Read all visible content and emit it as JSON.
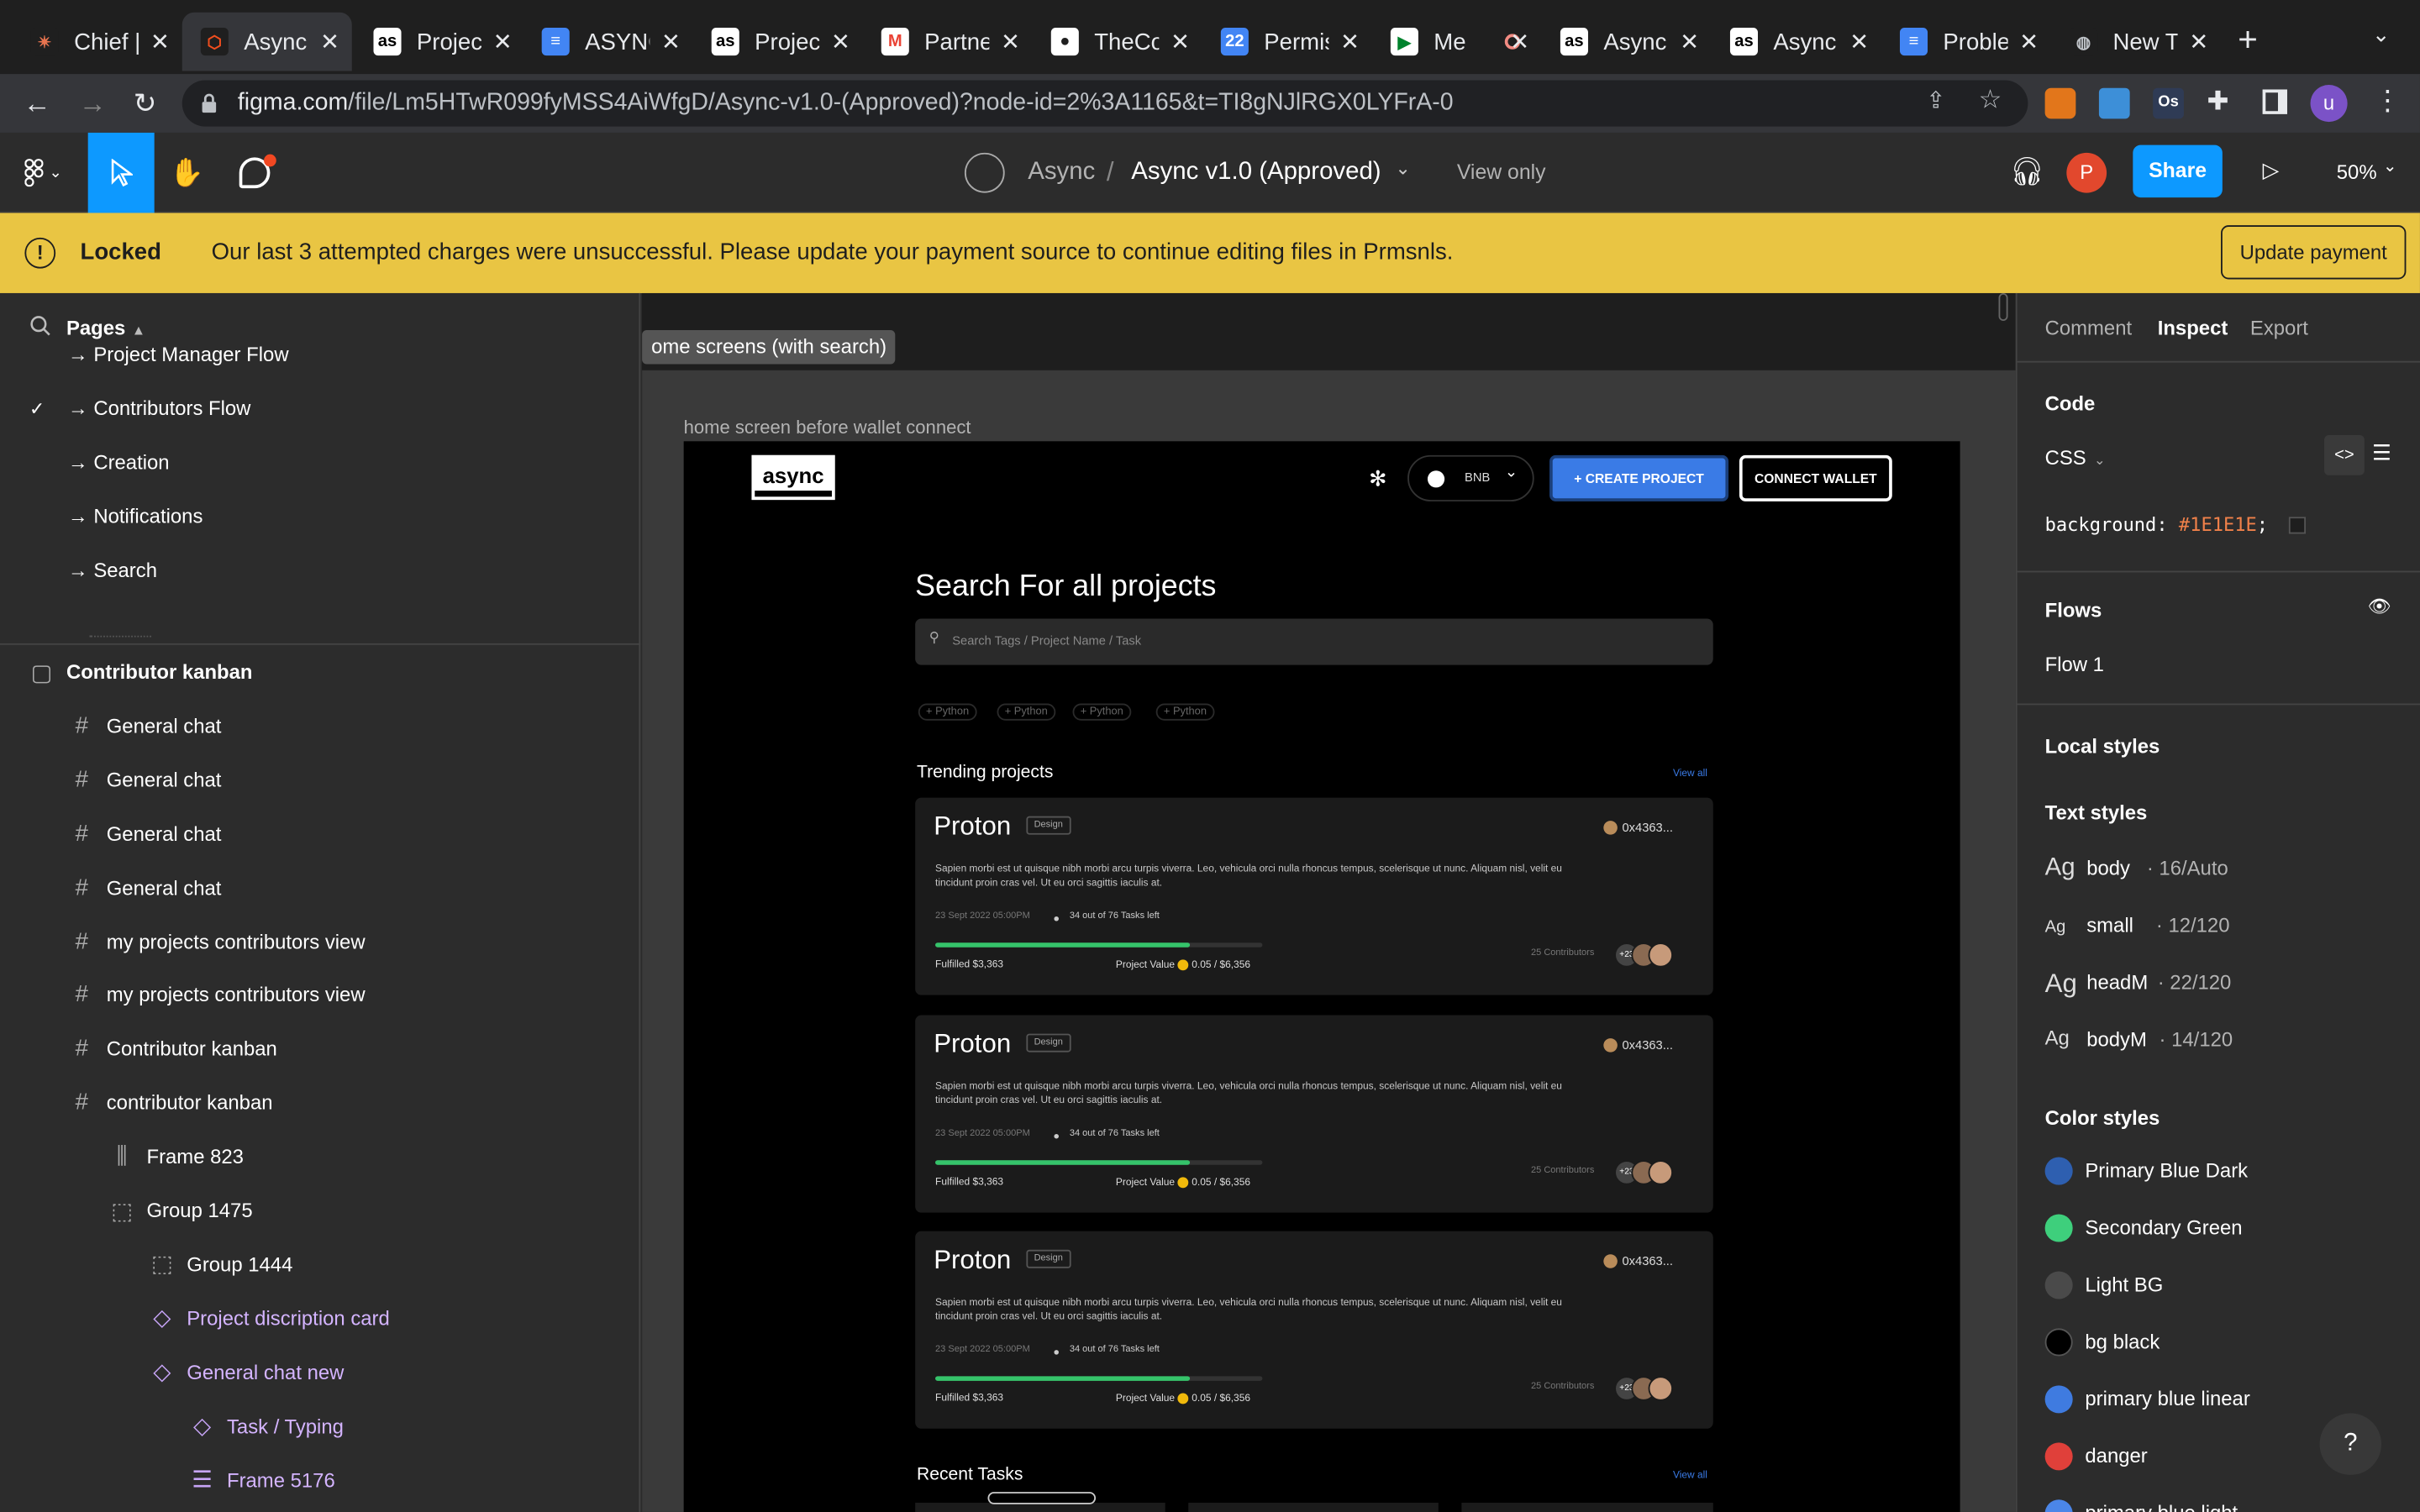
{
  "browser": {
    "tabs": [
      {
        "label": "Chief |",
        "icon": "claude-icon"
      },
      {
        "label": "Async",
        "icon": "figma-icon"
      },
      {
        "label": "Projec",
        "icon": "async-icon"
      },
      {
        "label": "ASYNC",
        "icon": "docs-icon"
      },
      {
        "label": "Projec",
        "icon": "async-icon"
      },
      {
        "label": "Partne",
        "icon": "gmail-icon"
      },
      {
        "label": "TheCo",
        "icon": "github-icon"
      },
      {
        "label": "Permis",
        "icon": "calendar-icon"
      },
      {
        "label": "Me",
        "icon": "meet-icon"
      },
      {
        "label": "Async",
        "icon": "async-icon"
      },
      {
        "label": "Async",
        "icon": "async-icon"
      },
      {
        "label": "Proble",
        "icon": "docs-icon"
      },
      {
        "label": "New T",
        "icon": "globe-icon"
      }
    ],
    "url_domain": "figma.com",
    "url_path": "/file/Lm5HTwR099fyMSS4AiWfgD/Async-v1.0-(Approved)?node-id=2%3A1165&t=TI8gNJlRGX0LYFrA-0",
    "profile_initial": "u"
  },
  "toolbar": {
    "team": "Async",
    "separator": "/",
    "file_name": "Async v1.0 (Approved)",
    "mode": "View only",
    "user_initial": "P",
    "share_label": "Share",
    "zoom": "50%"
  },
  "banner": {
    "title": "Locked",
    "message": "Our last 3 attempted charges were unsuccessful. Please update your payment source to continue editing files in Prmsnls.",
    "button": "Update payment"
  },
  "pages": {
    "header": "Pages",
    "items": [
      "→ Project Manager Flow",
      "→ Contributors Flow",
      "→ Creation",
      "→ Notifications",
      "→ Search"
    ]
  },
  "layers": [
    {
      "label": "Contributor kanban",
      "icon": "frame-outline-icon"
    },
    {
      "label": "General chat",
      "icon": "hash-icon"
    },
    {
      "label": "General chat",
      "icon": "hash-icon"
    },
    {
      "label": "General chat",
      "icon": "hash-icon"
    },
    {
      "label": "General chat",
      "icon": "hash-icon"
    },
    {
      "label": "my projects contributors view",
      "icon": "hash-icon"
    },
    {
      "label": "my projects contributors view",
      "icon": "hash-icon"
    },
    {
      "label": "Contributor kanban",
      "icon": "hash-icon"
    },
    {
      "label": "contributor kanban",
      "icon": "hash-icon"
    },
    {
      "label": "Frame 823",
      "icon": "columns-icon"
    },
    {
      "label": "Group 1475",
      "icon": "group-icon"
    },
    {
      "label": "Group 1444",
      "icon": "group-icon"
    },
    {
      "label": "Project discription card",
      "icon": "component-icon"
    },
    {
      "label": "General chat new",
      "icon": "component-icon"
    },
    {
      "label": "Task / Typing",
      "icon": "component-outline-icon"
    },
    {
      "label": "Frame 5176",
      "icon": "rows-icon"
    }
  ],
  "canvas": {
    "section_label": "ome screens (with search)",
    "frame_label": "home screen before wallet connect",
    "design": {
      "logo": "async",
      "network": "BNB",
      "create_button": "+ CREATE PROJECT",
      "connect_button": "CONNECT WALLET",
      "heading": "Search For all projects",
      "search_placeholder": "Search Tags / Project Name / Task",
      "tags": [
        "+ Python",
        "+ Python",
        "+ Python",
        "+ Python"
      ],
      "trending": "Trending projects",
      "view_all": "View all",
      "recent": "Recent Tasks",
      "recent_view_all": "View all",
      "cards": [
        {
          "title": "Proton",
          "tag": "Design",
          "address": "0x4363...",
          "description": "Sapien morbi est ut quisque nibh morbi arcu turpis viverra. Leo, vehicula orci nulla rhoncus tempus, scelerisque ut nunc. Aliquam nisl, velit eu tincidunt proin cras vel. Ut eu orci sagittis iaculis at.",
          "date": "23 Sept 2022 05:00PM",
          "tasks": "34 out of 76 Tasks left",
          "progress": 0.78,
          "fulfilled": "Fulfilled $3,363",
          "value_label": "Project Value",
          "value": "0.05  / $6,356",
          "contributors": "25 Contributors",
          "extra": "+23"
        },
        {
          "title": "Proton",
          "tag": "Design",
          "address": "0x4363...",
          "description": "Sapien morbi est ut quisque nibh morbi arcu turpis viverra. Leo, vehicula orci nulla rhoncus tempus, scelerisque ut nunc. Aliquam nisl, velit eu tincidunt proin cras vel. Ut eu orci sagittis iaculis at.",
          "date": "23 Sept 2022 05:00PM",
          "tasks": "34 out of 76 Tasks left",
          "progress": 0.78,
          "fulfilled": "Fulfilled $3,363",
          "value_label": "Project Value",
          "value": "0.05  / $6,356",
          "contributors": "25 Contributors",
          "extra": "+23"
        },
        {
          "title": "Proton",
          "tag": "Design",
          "address": "0x4363...",
          "description": "Sapien morbi est ut quisque nibh morbi arcu turpis viverra. Leo, vehicula orci nulla rhoncus tempus, scelerisque ut nunc. Aliquam nisl, velit eu tincidunt proin cras vel. Ut eu orci sagittis iaculis at.",
          "date": "23 Sept 2022 05:00PM",
          "tasks": "34 out of 76 Tasks left",
          "progress": 0.78,
          "fulfilled": "Fulfilled $3,363",
          "value_label": "Project Value",
          "value": "0.05  / $6,356",
          "contributors": "25 Contributors",
          "extra": "+23"
        }
      ]
    }
  },
  "inspect": {
    "tabs": [
      "Comment",
      "Inspect",
      "Export"
    ],
    "code_header": "Code",
    "lang": "CSS",
    "code_prop": "background:",
    "code_value": "#1E1E1E",
    "code_end": ";",
    "flows_header": "Flows",
    "flow_item": "Flow 1",
    "local_styles": "Local styles",
    "text_styles_header": "Text styles",
    "text_styles": [
      {
        "name": "body",
        "spec": " · 16/Auto"
      },
      {
        "name": "small",
        "spec": " · 12/120"
      },
      {
        "name": "headM",
        "spec": " · 22/120"
      },
      {
        "name": "bodyM",
        "spec": " · 14/120"
      }
    ],
    "color_styles_header": "Color styles",
    "color_styles": [
      {
        "name": "Primary Blue Dark",
        "color": "#2e5fb0"
      },
      {
        "name": "Secondary Green",
        "color": "#3ecf7c"
      },
      {
        "name": "Light BG",
        "color": "#4a4a4a"
      },
      {
        "name": "bg black",
        "color": "#000000"
      },
      {
        "name": "primary blue linear",
        "color": "#3f7be0"
      },
      {
        "name": "danger",
        "color": "#e0403a"
      },
      {
        "name": "primary blue light",
        "color": "#4b86e8"
      }
    ],
    "help": "?"
  },
  "colors": {
    "accent": "#0d99ff",
    "banner": "#e9c543",
    "share": "#0d99ff"
  }
}
